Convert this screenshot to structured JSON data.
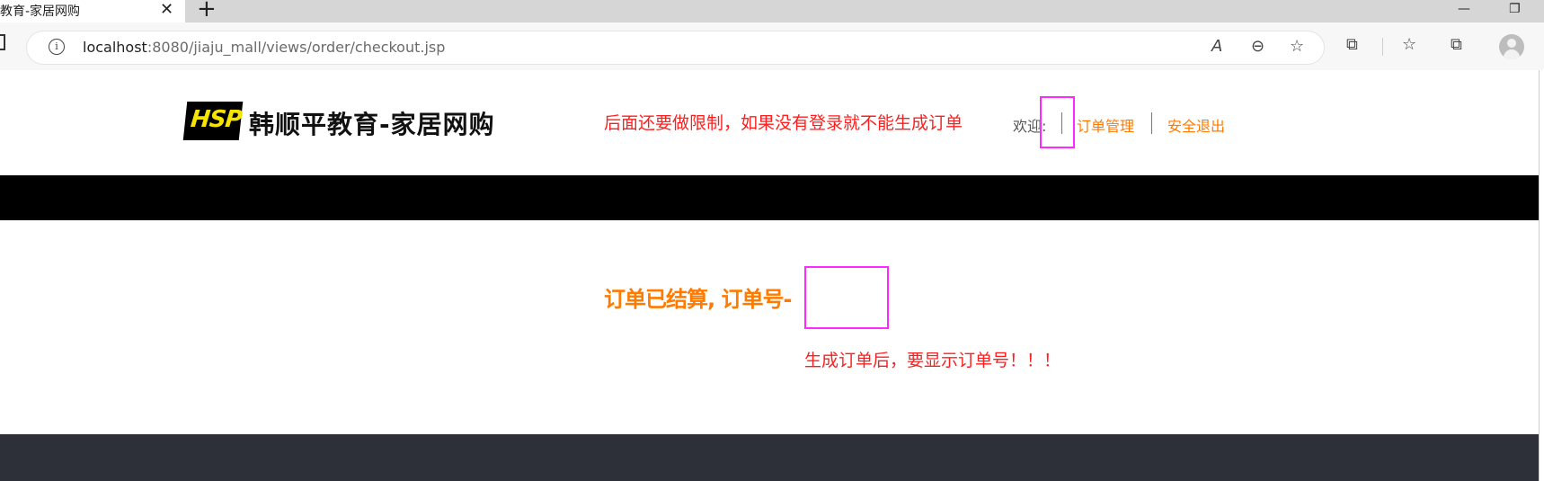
{
  "browser": {
    "tab_title": "教育-家居网购",
    "tab_close": "✕",
    "new_tab": "+",
    "win_minimize": "—",
    "win_restore": "❐",
    "url_host": "localhost",
    "url_rest": ":8080/jiaju_mall/views/order/checkout.jsp",
    "toolbar_icons": {
      "read_aloud": "A",
      "zoom_out": "⊖",
      "favorite_add": "☆",
      "extensions": "⧉",
      "favorites": "☆",
      "collections": "⧉"
    }
  },
  "header": {
    "logo_badge": "HSP",
    "logo_text": "韩顺平教育-家居网购",
    "annotation": "后面还要做限制，如果没有登录就不能生成订单",
    "welcome": "欢迎:",
    "username": "",
    "nav": {
      "orders": "订单管理",
      "logout": "安全退出"
    }
  },
  "main": {
    "order_message": "订单已结算, 订单号-",
    "order_number": "",
    "annotation": "生成订单后，要显示订单号！！！"
  },
  "colors": {
    "accent": "#ff7a00",
    "annotation_red": "#ff1e1e",
    "highlight_magenta": "#ff28ff",
    "nav_bar": "#000000",
    "footer": "#2d3039",
    "logo_yellow": "#f5e400"
  }
}
